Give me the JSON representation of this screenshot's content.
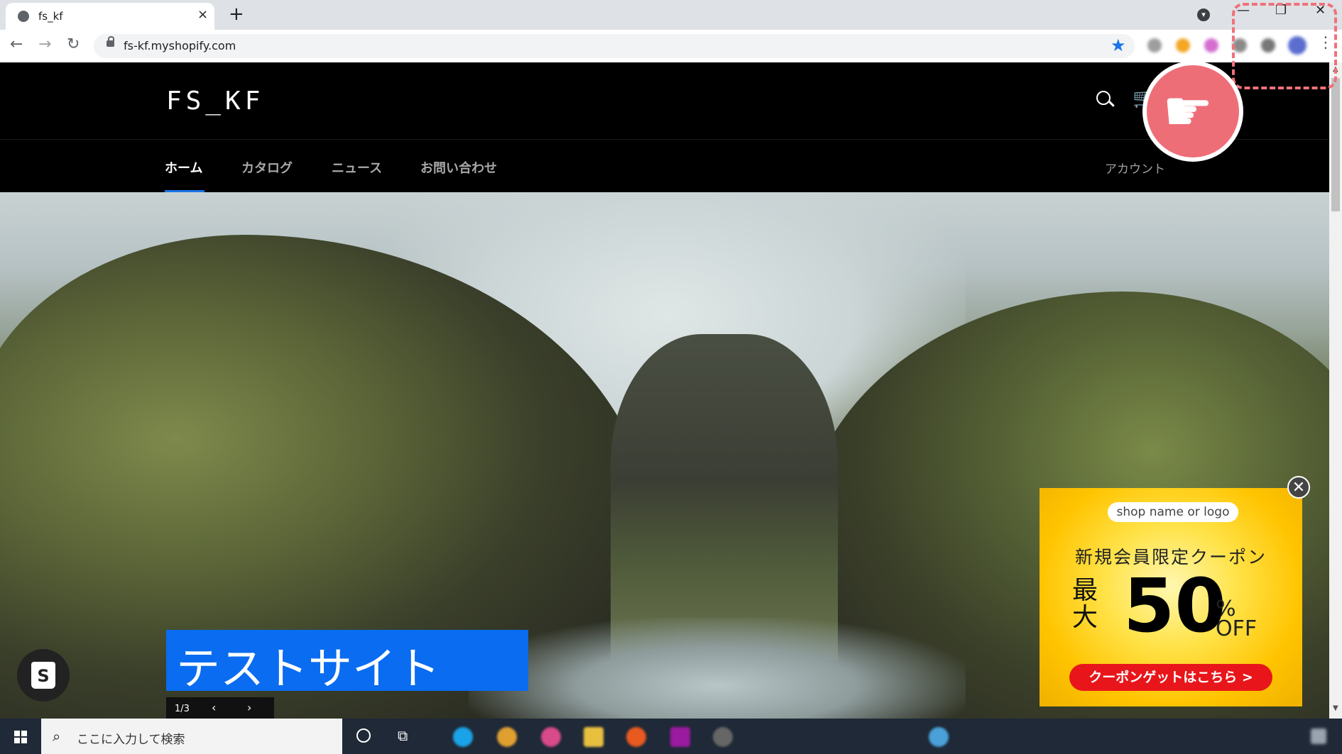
{
  "browser": {
    "tab_title": "fs_kf",
    "tab_close": "×",
    "new_tab": "+",
    "url": "fs-kf.myshopify.com",
    "min_btn": "—",
    "max_btn": "❐",
    "close_btn": "✕",
    "back": "←",
    "forward": "→",
    "reload": "↻",
    "star": "★",
    "menu": "⋮",
    "tab_search": "▾"
  },
  "site": {
    "logo": "FS_KF",
    "nav": [
      "ホーム",
      "カタログ",
      "ニュース",
      "お問い合わせ"
    ],
    "account": "アカウント",
    "cart_icon": "🛒"
  },
  "hero": {
    "title": "テストサイト",
    "slide_counter": "1/3",
    "prev": "‹",
    "next": "›"
  },
  "coupon": {
    "shop": "shop name or logo",
    "title": "新規会員限定クーポン",
    "max": "最大",
    "number": "50",
    "percent": "%",
    "off": "OFF",
    "cta": "クーポンゲットはこちら >",
    "close": "✕"
  },
  "overlay": {
    "hand": "☛"
  },
  "shopify_badge": {
    "letter": "S"
  },
  "taskbar": {
    "search_placeholder": "ここに入力して検索",
    "search_icon": "⌕",
    "taskview_icon": "⧉"
  },
  "colors": {
    "accent_blue": "#0a6cf0",
    "coupon_red": "#e8161a",
    "coupon_yellow": "#ffe34a",
    "overlay_pink": "#ee6e78"
  }
}
